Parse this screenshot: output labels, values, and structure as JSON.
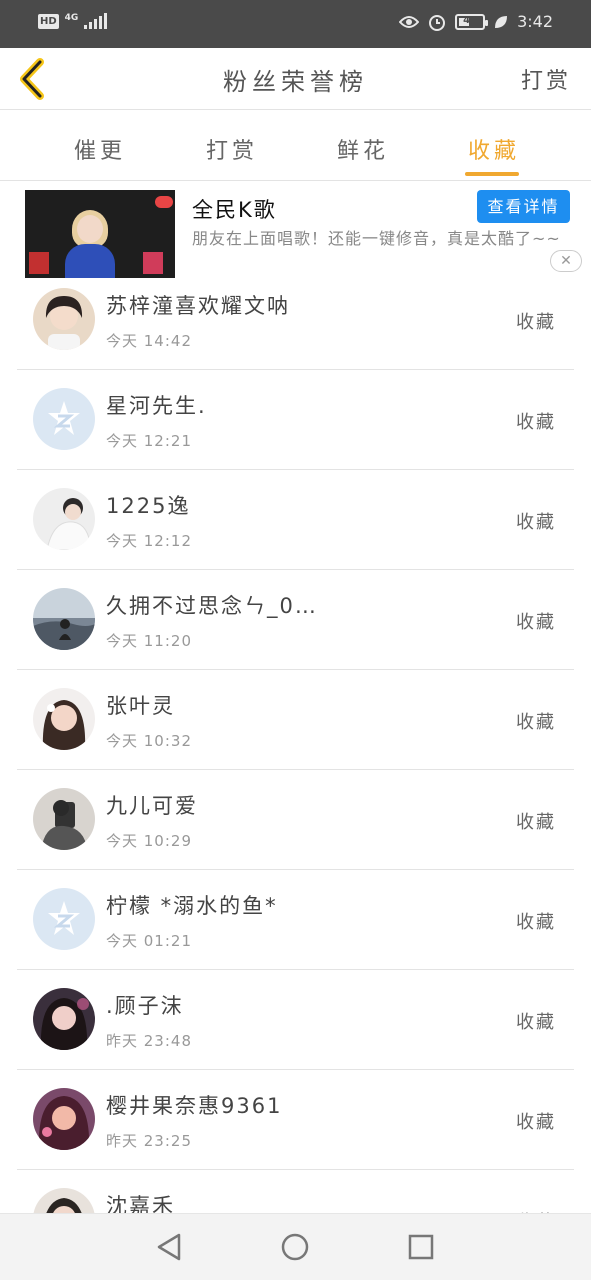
{
  "status_bar": {
    "hd": "HD",
    "network": "4G",
    "battery": "41",
    "time": "3:42",
    "icons": [
      "eye-icon",
      "alarm-icon",
      "battery-icon",
      "leaf-icon"
    ]
  },
  "header": {
    "title": "粉丝荣誉榜",
    "reward_label": "打赏",
    "back_icon": "chevron-left-icon"
  },
  "tabs": [
    {
      "label": "催更",
      "active": false
    },
    {
      "label": "打赏",
      "active": false
    },
    {
      "label": "鲜花",
      "active": false
    },
    {
      "label": "收藏",
      "active": true
    }
  ],
  "ad": {
    "title": "全民K歌",
    "description": "朋友在上面唱歌！还能一键修音，真是太酷了~~",
    "cta_label": "查看详情",
    "close_icon": "close-icon"
  },
  "list": [
    {
      "name": "苏梓潼喜欢耀文呐",
      "time": "今天 14:42",
      "action": "收藏",
      "avatar": "photo"
    },
    {
      "name": "星河先生.",
      "time": "今天 12:21",
      "action": "收藏",
      "avatar": "default"
    },
    {
      "name": "1225逸",
      "time": "今天 12:12",
      "action": "收藏",
      "avatar": "photo"
    },
    {
      "name": "久拥不过思念ㄣ_0…",
      "time": "今天 11:20",
      "action": "收藏",
      "avatar": "photo"
    },
    {
      "name": "张叶灵",
      "time": "今天 10:32",
      "action": "收藏",
      "avatar": "photo"
    },
    {
      "name": "九儿可爱",
      "time": "今天 10:29",
      "action": "收藏",
      "avatar": "photo"
    },
    {
      "name": "柠檬 *溺水的鱼*",
      "time": "今天 01:21",
      "action": "收藏",
      "avatar": "default"
    },
    {
      "name": ".顾子沫",
      "time": "昨天 23:48",
      "action": "收藏",
      "avatar": "photo"
    },
    {
      "name": "樱井果奈惠9361",
      "time": "昨天 23:25",
      "action": "收藏",
      "avatar": "photo"
    },
    {
      "name": "沈嘉禾",
      "time": "",
      "action": "收藏",
      "avatar": "photo"
    }
  ],
  "nav_bar": {
    "icons": [
      "back-triangle-icon",
      "home-circle-icon",
      "recents-square-icon"
    ]
  },
  "colors": {
    "accent": "#f0a830",
    "status_bar": "#4a4a4a",
    "cta_blue": "#1e8ef0"
  }
}
